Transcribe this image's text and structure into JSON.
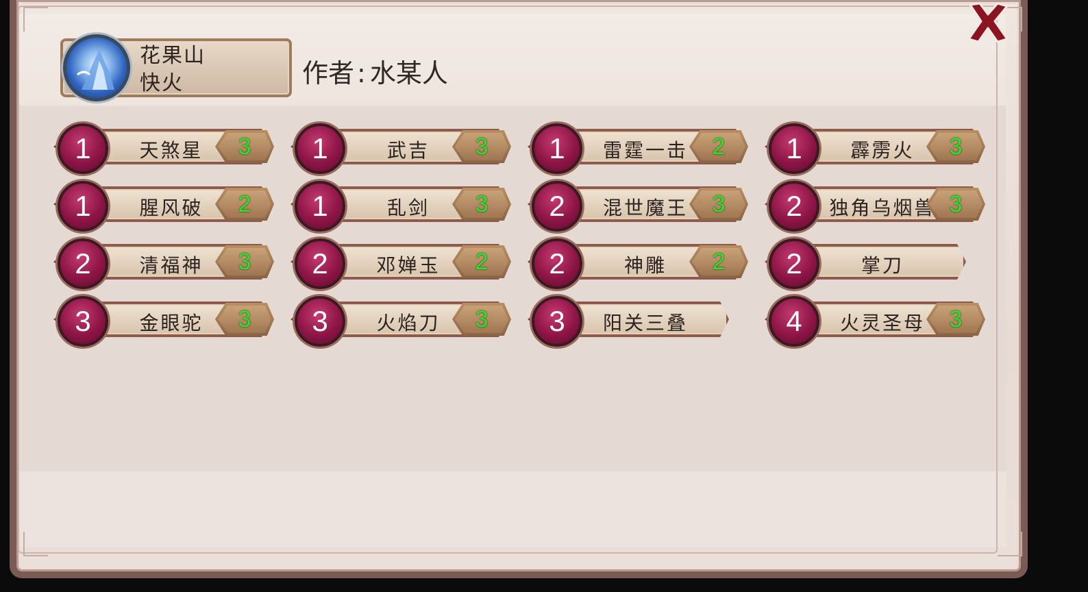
{
  "header": {
    "badge_line1": "花果山",
    "badge_line2": "快火",
    "author_label": "作者",
    "author_colon": ":",
    "author_name": "水某人"
  },
  "close_icon": "close-x-icon",
  "colors": {
    "level_circle": "#8d1546",
    "count_text": "#2ee22a",
    "close_x": "#8a1420"
  },
  "items": [
    {
      "level": "1",
      "name": "天煞星",
      "count": "3"
    },
    {
      "level": "1",
      "name": "武吉",
      "count": "3"
    },
    {
      "level": "1",
      "name": "雷霆一击",
      "count": "2"
    },
    {
      "level": "1",
      "name": "霹雳火",
      "count": "3"
    },
    {
      "level": "1",
      "name": "腥风破",
      "count": "2"
    },
    {
      "level": "1",
      "name": "乱剑",
      "count": "3"
    },
    {
      "level": "2",
      "name": "混世魔王",
      "count": "3"
    },
    {
      "level": "2",
      "name": "独角乌烟兽",
      "count": "3"
    },
    {
      "level": "2",
      "name": "清福神",
      "count": "3"
    },
    {
      "level": "2",
      "name": "邓婵玉",
      "count": "2"
    },
    {
      "level": "2",
      "name": "神雕",
      "count": "2"
    },
    {
      "level": "2",
      "name": "掌刀",
      "count": null
    },
    {
      "level": "3",
      "name": "金眼驼",
      "count": "3"
    },
    {
      "level": "3",
      "name": "火焰刀",
      "count": "3"
    },
    {
      "level": "3",
      "name": "阳关三叠",
      "count": null
    },
    {
      "level": "4",
      "name": "火灵圣母",
      "count": "3"
    }
  ]
}
